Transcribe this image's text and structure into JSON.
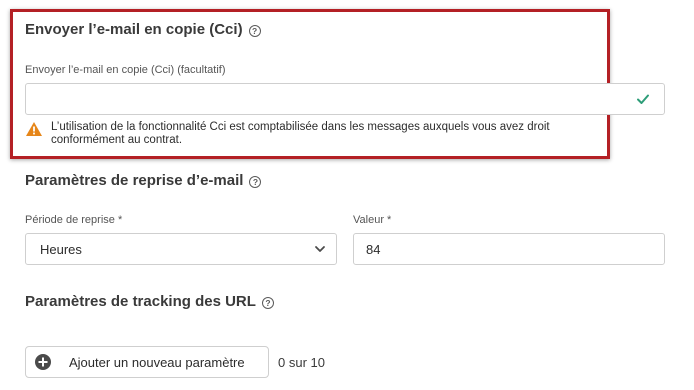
{
  "bcc_section": {
    "title": "Envoyer l’e-mail en copie (Cci)",
    "field_label": "Envoyer l’e-mail en copie (Cci) (facultatif)",
    "input_value": "",
    "warning_text": "L’utilisation de la fonctionnalité Cci est comptabilisée dans les messages auxquels vous avez droit conformément au contrat."
  },
  "retry_section": {
    "title": "Paramètres de reprise d’e-mail",
    "period_label": "Période de reprise *",
    "period_value": "Heures",
    "value_label": "Valeur *",
    "value_value": "84"
  },
  "tracking_section": {
    "title": "Paramètres de tracking des URL",
    "add_button_label": "Ajouter un nouveau paramètre",
    "counter": "0 sur 10"
  },
  "colors": {
    "highlight_border": "#b42025",
    "check_green": "#2d9d78",
    "warning_orange": "#e68619"
  }
}
